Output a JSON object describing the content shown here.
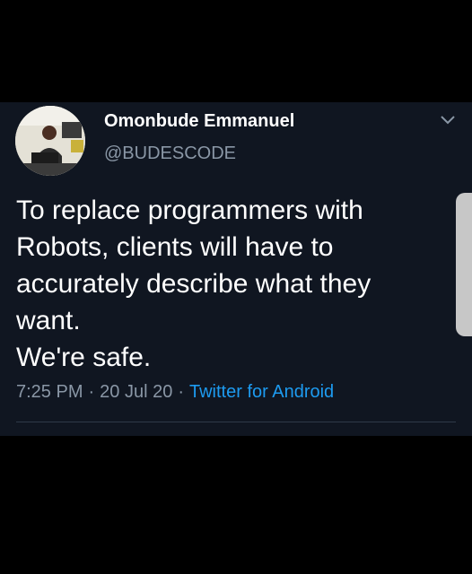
{
  "tweet": {
    "author_name": "Omonbude Emmanuel",
    "author_handle": "@BUDESCODE",
    "text_lines": [
      "To replace programmers with",
      "Robots, clients will have to",
      "accurately describe what they",
      "want.",
      "We're safe."
    ],
    "time": "7:25 PM",
    "separator": "·",
    "date": "20 Jul 20",
    "source": "Twitter for Android"
  },
  "icons": {
    "menu": "chevron-down-icon",
    "avatar": "profile-photo"
  },
  "colors": {
    "card_background": "#101621",
    "page_background": "#000000",
    "link": "#1d9bf0",
    "secondary_text": "#8a97a6"
  }
}
